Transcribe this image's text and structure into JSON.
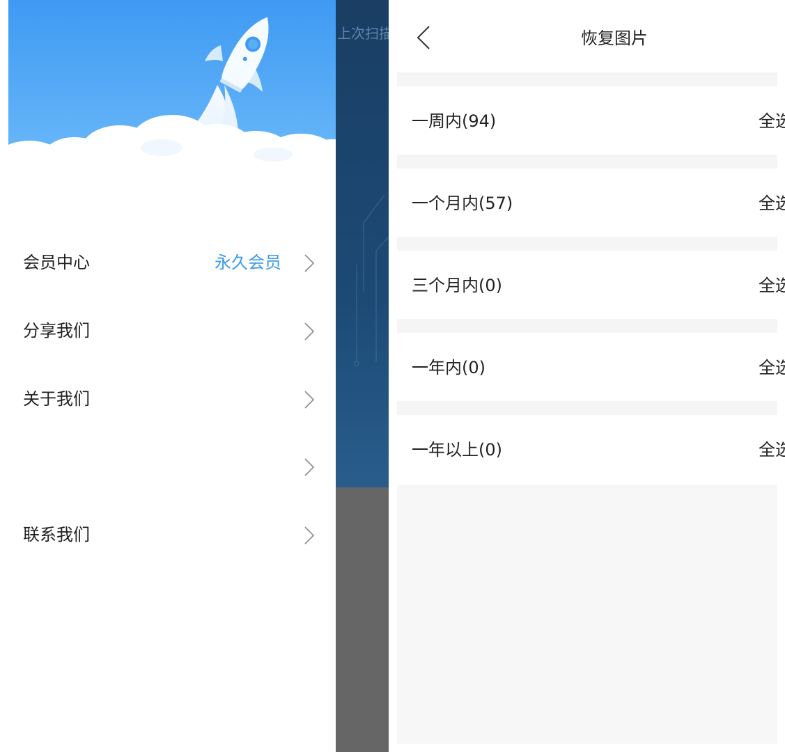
{
  "drawer": {
    "menu": [
      {
        "label": "会员中心",
        "value": "永久会员"
      },
      {
        "label": "分享我们",
        "value": ""
      },
      {
        "label": "关于我们",
        "value": ""
      },
      {
        "label": "",
        "value": ""
      },
      {
        "label": "联系我们",
        "value": ""
      }
    ]
  },
  "background_screen": {
    "scan_text": "上次扫描"
  },
  "recover": {
    "title": "恢复图片",
    "periods": [
      {
        "label": "一周内(94)",
        "action": "全选"
      },
      {
        "label": "一个月内(57)",
        "action": "全选"
      },
      {
        "label": "三个月内(0)",
        "action": "全选"
      },
      {
        "label": "一年内(0)",
        "action": "全选"
      },
      {
        "label": "一年以上(0)",
        "action": "全选"
      }
    ]
  },
  "colors": {
    "accent": "#3a9be8",
    "hero_blue": "#4aa3f5",
    "page_gray": "#f5f5f5"
  }
}
